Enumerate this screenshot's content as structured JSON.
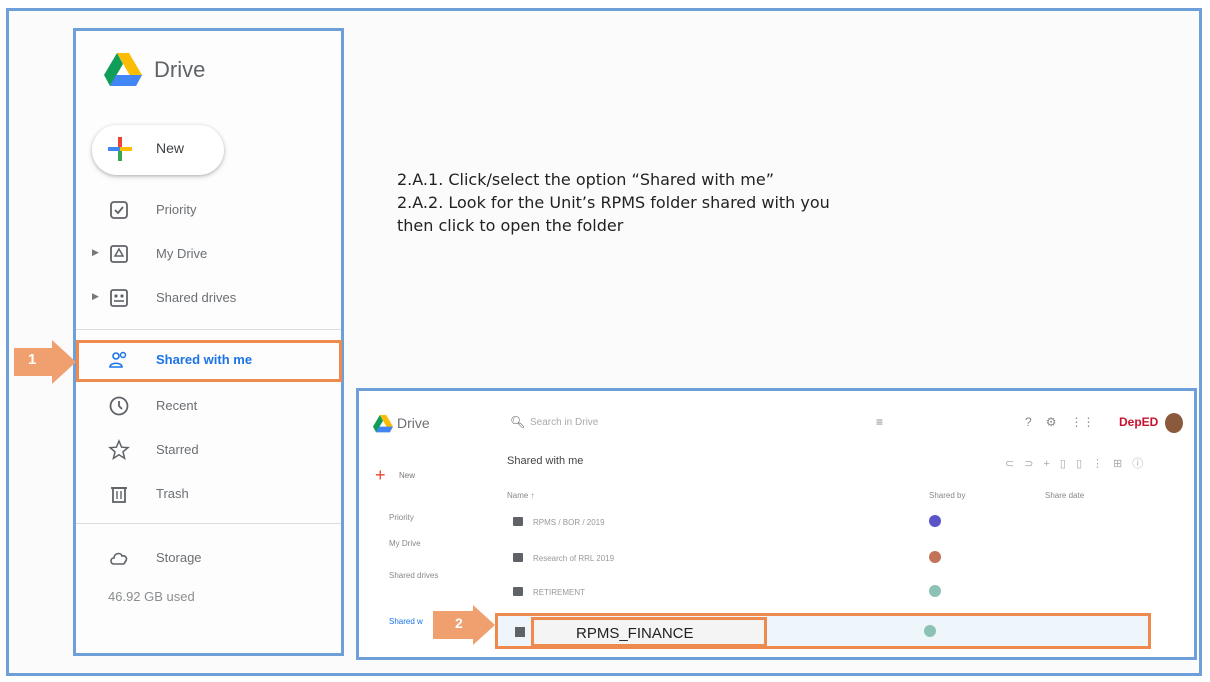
{
  "app": {
    "title": "Drive"
  },
  "sidebar": {
    "new_label": "New",
    "items": [
      {
        "label": "Priority",
        "icon": "checkbox-icon"
      },
      {
        "label": "My Drive",
        "icon": "drive-folder-icon"
      },
      {
        "label": "Shared drives",
        "icon": "shared-drives-icon"
      },
      {
        "label": "Shared with me",
        "icon": "people-icon"
      },
      {
        "label": "Recent",
        "icon": "clock-icon"
      },
      {
        "label": "Starred",
        "icon": "star-icon"
      },
      {
        "label": "Trash",
        "icon": "trash-icon"
      },
      {
        "label": "Storage",
        "icon": "cloud-icon"
      }
    ],
    "storage_used": "46.92 GB used"
  },
  "callouts": {
    "step1": "1",
    "step2": "2"
  },
  "instructions": {
    "line1": "2.A.1. Click/select the option “Shared with me”",
    "line2": "2.A.2. Look for the Unit’s RPMS folder shared with you",
    "line3": "then click to open the folder"
  },
  "inner": {
    "title": "Drive",
    "search_placeholder": "Search in Drive",
    "heading": "Shared with me",
    "col_name": "Name ↑",
    "col_shared_by": "Shared by",
    "col_share_date": "Share date",
    "side_new": "New",
    "side_items": [
      "Priority",
      "My Drive",
      "Shared drives",
      "Shared w"
    ],
    "rows": [
      {
        "name": "RPMS / BOR / 2019",
        "shared_by": "",
        "date": ""
      },
      {
        "name": "Research of RRL 2019",
        "shared_by": "",
        "date": ""
      },
      {
        "name": "RETIREMENT",
        "shared_by": "",
        "date": ""
      }
    ],
    "target_name": "RPMS_FINANCE",
    "brand": "DepED",
    "colors": {
      "highlight": "#ee8a4e",
      "frame": "#6f9fd8",
      "accent": "#1a73e8"
    }
  }
}
